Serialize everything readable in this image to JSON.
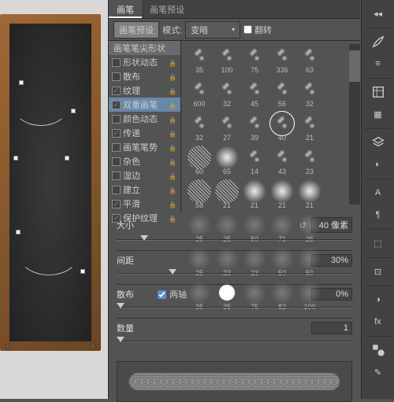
{
  "tabs": {
    "brush": "画笔",
    "presets": "画笔预设"
  },
  "toolbar": {
    "preset_btn": "画笔预设",
    "mode_label": "模式:",
    "mode_value": "变暗",
    "flip": "翻转"
  },
  "options": {
    "header": "画笔笔尖形状",
    "items": [
      {
        "label": "形状动态",
        "checked": false,
        "lock": true
      },
      {
        "label": "散布",
        "checked": false,
        "lock": true
      },
      {
        "label": "纹理",
        "checked": true,
        "lock": true
      },
      {
        "label": "双重画笔",
        "checked": true,
        "lock": true,
        "selected": true
      },
      {
        "label": "颜色动态",
        "checked": false,
        "lock": true
      },
      {
        "label": "传递",
        "checked": true,
        "lock": true
      },
      {
        "label": "画笔笔势",
        "checked": false,
        "lock": true
      },
      {
        "label": "杂色",
        "checked": false,
        "lock": true
      },
      {
        "label": "湿边",
        "checked": false,
        "lock": true
      },
      {
        "label": "建立",
        "checked": false,
        "lock": true
      },
      {
        "label": "平滑",
        "checked": true,
        "lock": true
      },
      {
        "label": "保护纹理",
        "checked": true,
        "lock": true
      }
    ]
  },
  "brushes": [
    {
      "size": "35",
      "type": "scatter"
    },
    {
      "size": "100",
      "type": "scatter"
    },
    {
      "size": "75",
      "type": "scatter"
    },
    {
      "size": "336",
      "type": "scatter"
    },
    {
      "size": "63",
      "type": "scatter"
    },
    {
      "size": "600",
      "type": "scatter"
    },
    {
      "size": "32",
      "type": "scatter"
    },
    {
      "size": "45",
      "type": "scatter"
    },
    {
      "size": "56",
      "type": "scatter"
    },
    {
      "size": "32",
      "type": "scatter"
    },
    {
      "size": "32",
      "type": "scatter"
    },
    {
      "size": "27",
      "type": "scatter"
    },
    {
      "size": "39",
      "type": "scatter"
    },
    {
      "size": "40",
      "type": "scatter",
      "selected": true
    },
    {
      "size": "21",
      "type": "scatter"
    },
    {
      "size": "60",
      "type": "texture"
    },
    {
      "size": "65",
      "type": "soft"
    },
    {
      "size": "14",
      "type": "scatter"
    },
    {
      "size": "43",
      "type": "scatter"
    },
    {
      "size": "23",
      "type": "scatter"
    },
    {
      "size": "58",
      "type": "texture"
    },
    {
      "size": "21",
      "type": "texture"
    },
    {
      "size": "21",
      "type": "soft"
    },
    {
      "size": "21",
      "type": "soft"
    },
    {
      "size": "21",
      "type": "soft"
    },
    {
      "size": "25",
      "type": "dim"
    },
    {
      "size": "25",
      "type": "dim"
    },
    {
      "size": "50",
      "type": "dim"
    },
    {
      "size": "71",
      "type": "dim"
    },
    {
      "size": "25",
      "type": "dim"
    },
    {
      "size": "25",
      "type": "dim"
    },
    {
      "size": "23",
      "type": "dim"
    },
    {
      "size": "23",
      "type": "dim"
    },
    {
      "size": "50",
      "type": "dim"
    },
    {
      "size": "50",
      "type": "dim"
    },
    {
      "size": "35",
      "type": "dim"
    },
    {
      "size": "35",
      "type": "solid"
    },
    {
      "size": "75",
      "type": "dim"
    },
    {
      "size": "82",
      "type": "dim"
    },
    {
      "size": "100",
      "type": "dim"
    }
  ],
  "sliders": {
    "size": {
      "label": "大小",
      "value": "40 像素",
      "pos": 10
    },
    "spacing": {
      "label": "间距",
      "value": "30%",
      "pos": 22
    },
    "scatter": {
      "label": "散布",
      "both_axes": "两轴",
      "value": "0%",
      "pos": 0
    },
    "count": {
      "label": "数量",
      "value": "1",
      "pos": 0
    }
  }
}
